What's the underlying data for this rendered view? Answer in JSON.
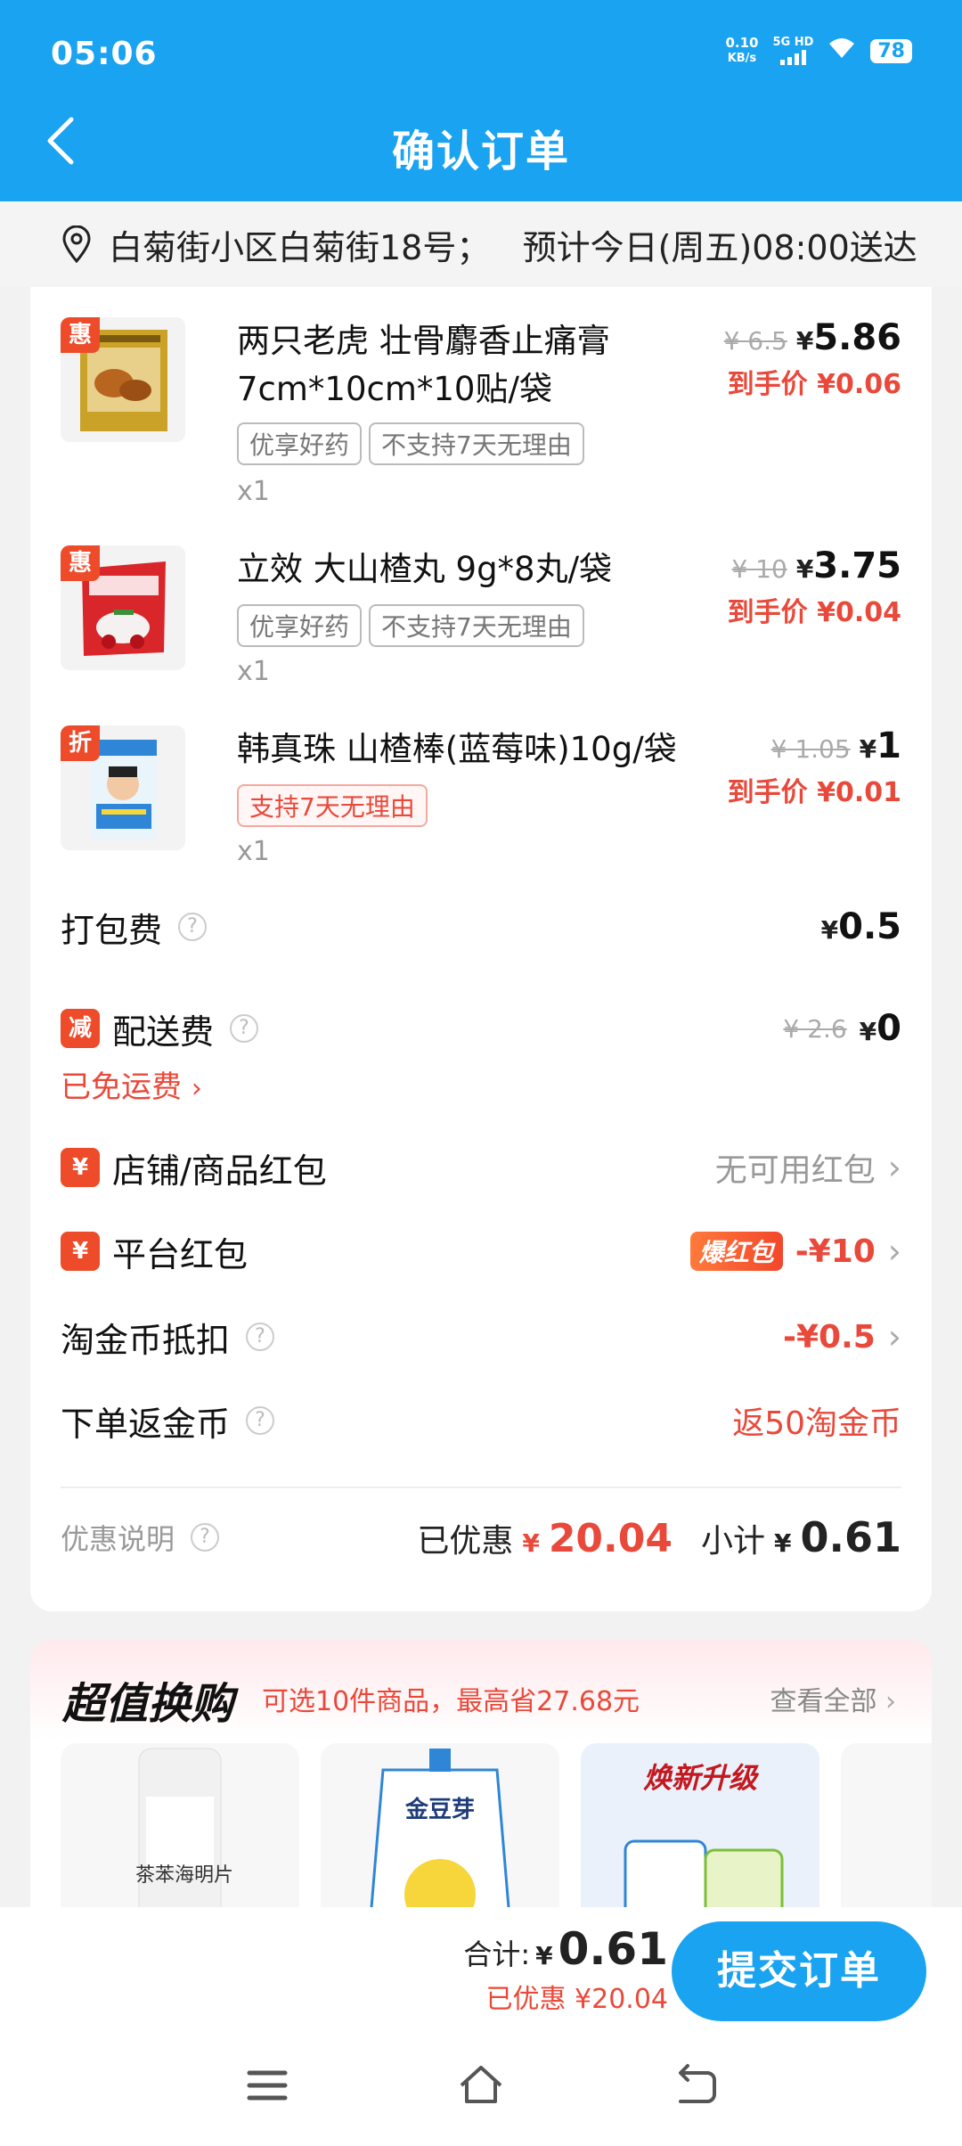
{
  "status": {
    "time": "05:06",
    "net_speed": "0.10",
    "net_unit": "KB/s",
    "signal": "5G HD",
    "battery": "78"
  },
  "header": {
    "title": "确认订单"
  },
  "address": {
    "text": "白菊街小区白菊街18号；   预计今日(周五)08:00送达"
  },
  "items": [
    {
      "tag": "惠",
      "name": "两只老虎 壮骨麝香止痛膏7cm*10cm*10贴/袋",
      "tags": [
        "优享好药",
        "不支持7天无理由"
      ],
      "qty": "x1",
      "orig": "¥ 6.5",
      "price": "5.86",
      "hand": "到手价 ¥0.06"
    },
    {
      "tag": "惠",
      "name": "立效 大山楂丸 9g*8丸/袋",
      "tags": [
        "优享好药",
        "不支持7天无理由"
      ],
      "qty": "x1",
      "orig": "¥ 10",
      "price": "3.75",
      "hand": "到手价 ¥0.04"
    },
    {
      "tag": "折",
      "name": "韩真珠 山楂棒(蓝莓味)10g/袋",
      "tags": [
        "支持7天无理由"
      ],
      "qty": "x1",
      "orig": "¥ 1.05",
      "price": "1",
      "hand": "到手价 ¥0.01"
    }
  ],
  "fees": {
    "packing_label": "打包费",
    "packing_value": "0.5",
    "delivery_badge": "减",
    "delivery_label": "配送费",
    "delivery_orig": "¥ 2.6",
    "delivery_value": "0",
    "free_ship": "已免运费"
  },
  "coupons": {
    "shop_label": "店铺/商品红包",
    "shop_value": "无可用红包",
    "platform_label": "平台红包",
    "platform_badge": "爆红包",
    "platform_value": "-¥10",
    "coin_label": "淘金币抵扣",
    "coin_value": "-¥0.5",
    "return_label": "下单返金币",
    "return_value": "返50淘金币"
  },
  "summary": {
    "promo_label": "优惠说明",
    "saved_label": "已优惠",
    "saved_value": "20.04",
    "subtotal_label": "小计",
    "subtotal_value": "0.61"
  },
  "promo": {
    "title": "超值换购",
    "subtitle": "可选10件商品，最高省27.68元",
    "view_all": "查看全部",
    "cards": [
      {
        "text": "茶苯海明片"
      },
      {
        "text": "金豆芽"
      },
      {
        "text": "焕新升级"
      }
    ]
  },
  "footer": {
    "total_label": "合计:",
    "total_value": "0.61",
    "saved": "已优惠 ¥20.04",
    "submit": "提交订单"
  },
  "colors": {
    "brand": "#1aa3f0",
    "accent": "#e9493a"
  }
}
